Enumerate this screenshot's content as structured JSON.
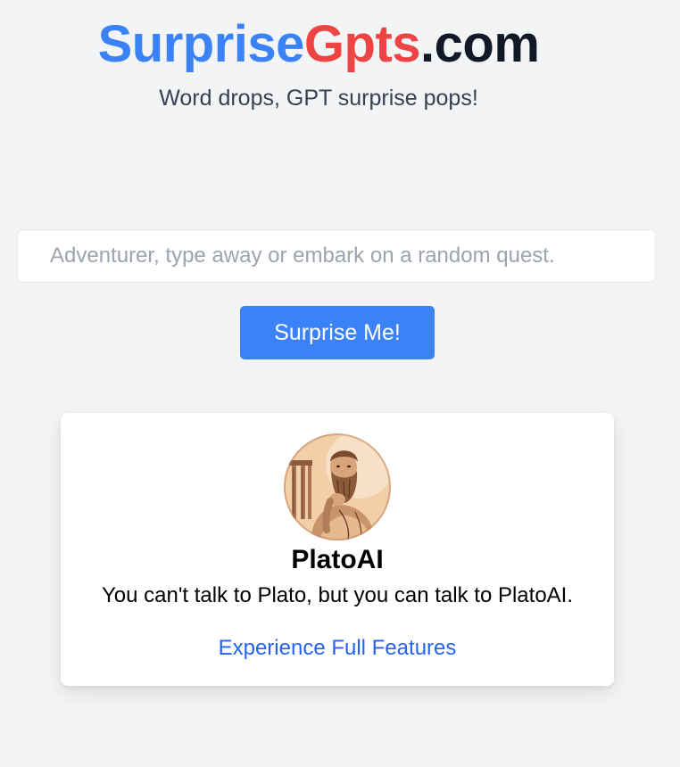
{
  "header": {
    "logo_part1": "Surprise",
    "logo_part2": "Gpts",
    "logo_part3": ".com",
    "tagline": "Word drops, GPT surprise pops!"
  },
  "search": {
    "placeholder": "Adventurer, type away or embark on a random quest.",
    "value": ""
  },
  "actions": {
    "surprise_label": "Surprise Me!"
  },
  "result_card": {
    "avatar_icon": "plato-portrait-avatar",
    "title": "PlatoAI",
    "description": "You can't talk to Plato, but you can talk to PlatoAI.",
    "link_label": "Experience Full Features"
  },
  "colors": {
    "brand_blue": "#3b82f6",
    "brand_red": "#ef4444",
    "brand_dark": "#111827",
    "link_blue": "#2563eb",
    "page_bg": "#f3f4f6"
  }
}
